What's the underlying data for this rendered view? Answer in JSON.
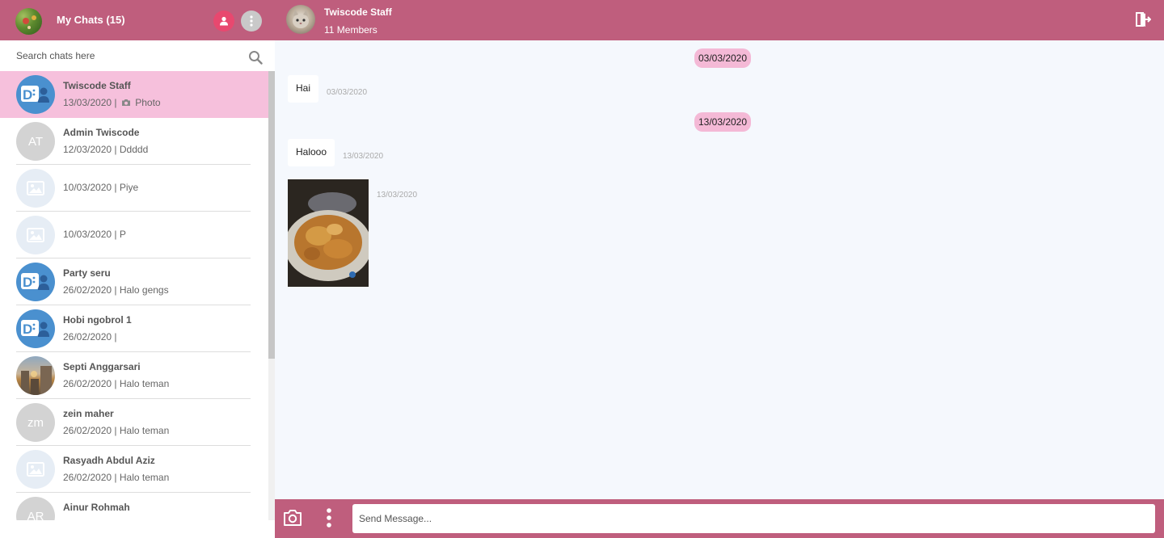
{
  "sidebar": {
    "title": "My Chats (15)",
    "search_placeholder": "Search chats here",
    "chats": [
      {
        "name": "Twiscode Staff",
        "date": "13/03/2020",
        "separator": "|",
        "last_message": "Photo",
        "avatar": "logo",
        "active": true
      },
      {
        "name": "Admin Twiscode",
        "date": "12/03/2020",
        "separator": "|",
        "last_message": "Ddddd",
        "avatar": "initials",
        "initials": "AT"
      },
      {
        "name": "",
        "date": "10/03/2020",
        "separator": "|",
        "last_message": "Piye",
        "avatar": "placeholder"
      },
      {
        "name": "",
        "date": "10/03/2020",
        "separator": "|",
        "last_message": "P",
        "avatar": "placeholder"
      },
      {
        "name": "Party seru",
        "date": "26/02/2020",
        "separator": "|",
        "last_message": "Halo gengs",
        "avatar": "logo"
      },
      {
        "name": "Hobi ngobrol 1",
        "date": "26/02/2020",
        "separator": "|",
        "last_message": "",
        "avatar": "logo"
      },
      {
        "name": "Septi Anggarsari",
        "date": "26/02/2020",
        "separator": "|",
        "last_message": "Halo teman",
        "avatar": "photo"
      },
      {
        "name": "zein maher",
        "date": "26/02/2020",
        "separator": "|",
        "last_message": "Halo teman",
        "avatar": "initials",
        "initials": "zm"
      },
      {
        "name": "Rasyadh Abdul Aziz",
        "date": "26/02/2020",
        "separator": "|",
        "last_message": "Halo teman",
        "avatar": "placeholder"
      },
      {
        "name": "Ainur Rohmah",
        "date": "",
        "separator": "",
        "last_message": "",
        "avatar": "initials",
        "initials": "AR"
      }
    ]
  },
  "conversation": {
    "group_name": "Twiscode Staff",
    "members": "11 Members",
    "dates": [
      "03/03/2020",
      "13/03/2020"
    ],
    "messages": [
      {
        "text": "Hai",
        "time": "03/03/2020"
      },
      {
        "text": "Halooo",
        "time": "13/03/2020"
      },
      {
        "type": "image",
        "time": "13/03/2020"
      }
    ]
  },
  "composer": {
    "placeholder": "Send Message..."
  },
  "colors": {
    "header": "#bf5e7d",
    "active_chat": "#f6c0dc",
    "date_pill": "#f4b9d6",
    "user_button": "#e8486f"
  },
  "icons": {
    "user": "user-icon",
    "more": "more-vertical-icon",
    "search": "search-icon",
    "exit": "exit-icon",
    "camera": "camera-icon"
  }
}
